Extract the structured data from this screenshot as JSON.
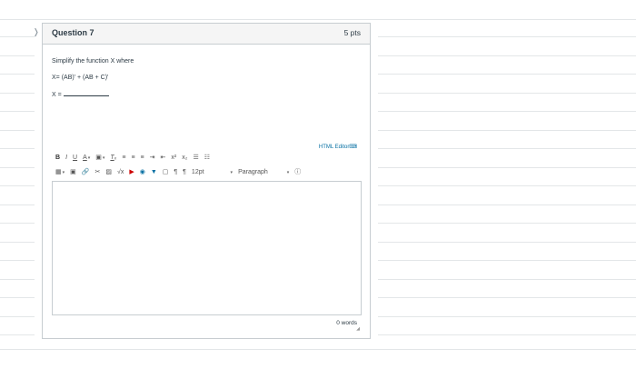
{
  "question": {
    "title": "Question 7",
    "points": "5 pts",
    "prompt": "Simplify the function X where",
    "expression": "X= (AB)' + (AB + C)'",
    "answer_label": "X ="
  },
  "editor": {
    "html_editor_link": "HTML Editor",
    "font_size": "12pt",
    "paragraph": "Paragraph",
    "word_count": "0 words",
    "toolbar_icons": [
      "bold-icon",
      "italic-icon",
      "underline-icon",
      "text-color-icon",
      "background-color-icon",
      "clear-formatting-icon",
      "align-left-icon",
      "align-center-icon",
      "align-right-icon",
      "indent-icon",
      "outdent-icon",
      "superscript-icon",
      "subscript-icon",
      "bullet-list-icon",
      "numbered-list-icon",
      "table-icon",
      "media-icon",
      "link-icon",
      "unlink-icon",
      "image-icon",
      "equation-icon",
      "youtube-icon",
      "google-drive-icon",
      "v-icon",
      "embed-icon",
      "ltr-icon",
      "rtl-icon",
      "help-icon"
    ]
  },
  "colors": {
    "link": "#0770a3",
    "border": "#c7cdd1",
    "header_bg": "#f5f5f5"
  }
}
